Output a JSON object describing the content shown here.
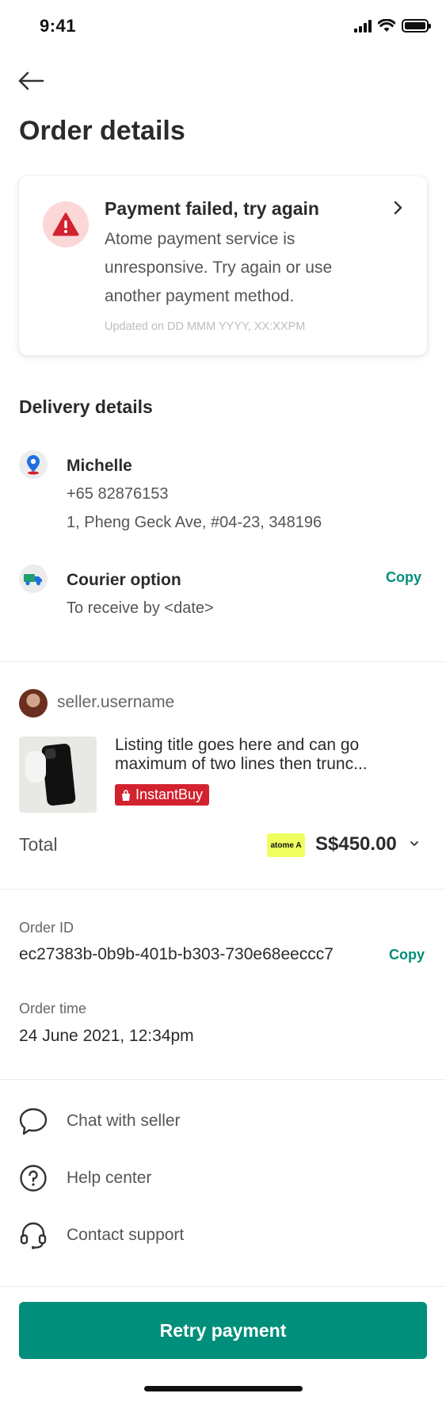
{
  "status_bar": {
    "time": "9:41"
  },
  "header": {
    "title": "Order details"
  },
  "alert": {
    "title": "Payment failed, try again",
    "message": "Atome payment service is unresponsive. Try again or use another payment method.",
    "updated": "Updated on DD MMM YYYY, XX:XXPM",
    "accent_color": "#d3222f",
    "icon": "warning-triangle-icon"
  },
  "delivery": {
    "section_title": "Delivery details",
    "recipient_name": "Michelle",
    "phone": "+65 82876153",
    "address": "1, Pheng Geck Ave, #04-23, 348196",
    "courier_label": "Courier option",
    "courier_detail": "To receive by <date>",
    "copy_label": "Copy"
  },
  "listing": {
    "seller_username": "seller.username",
    "title_line1": "Listing title goes here and can go",
    "title_line2": "maximum of two lines then trunc...",
    "badge_label": "InstantBuy",
    "badge_color": "#d3222f"
  },
  "total": {
    "label": "Total",
    "payment_logo": "atome A",
    "amount": "S$450.00"
  },
  "order": {
    "id_label": "Order ID",
    "id_value": "ec27383b-0b9b-401b-b303-730e68eeccc7",
    "copy_label": "Copy",
    "time_label": "Order time",
    "time_value": "24 June 2021, 12:34pm"
  },
  "actions": [
    {
      "label": "Chat with seller",
      "icon": "chat-bubble-icon"
    },
    {
      "label": "Help center",
      "icon": "help-circle-icon"
    },
    {
      "label": "Contact support",
      "icon": "headset-icon"
    }
  ],
  "footer": {
    "cta_label": "Retry payment",
    "cta_color": "#008f7a"
  }
}
